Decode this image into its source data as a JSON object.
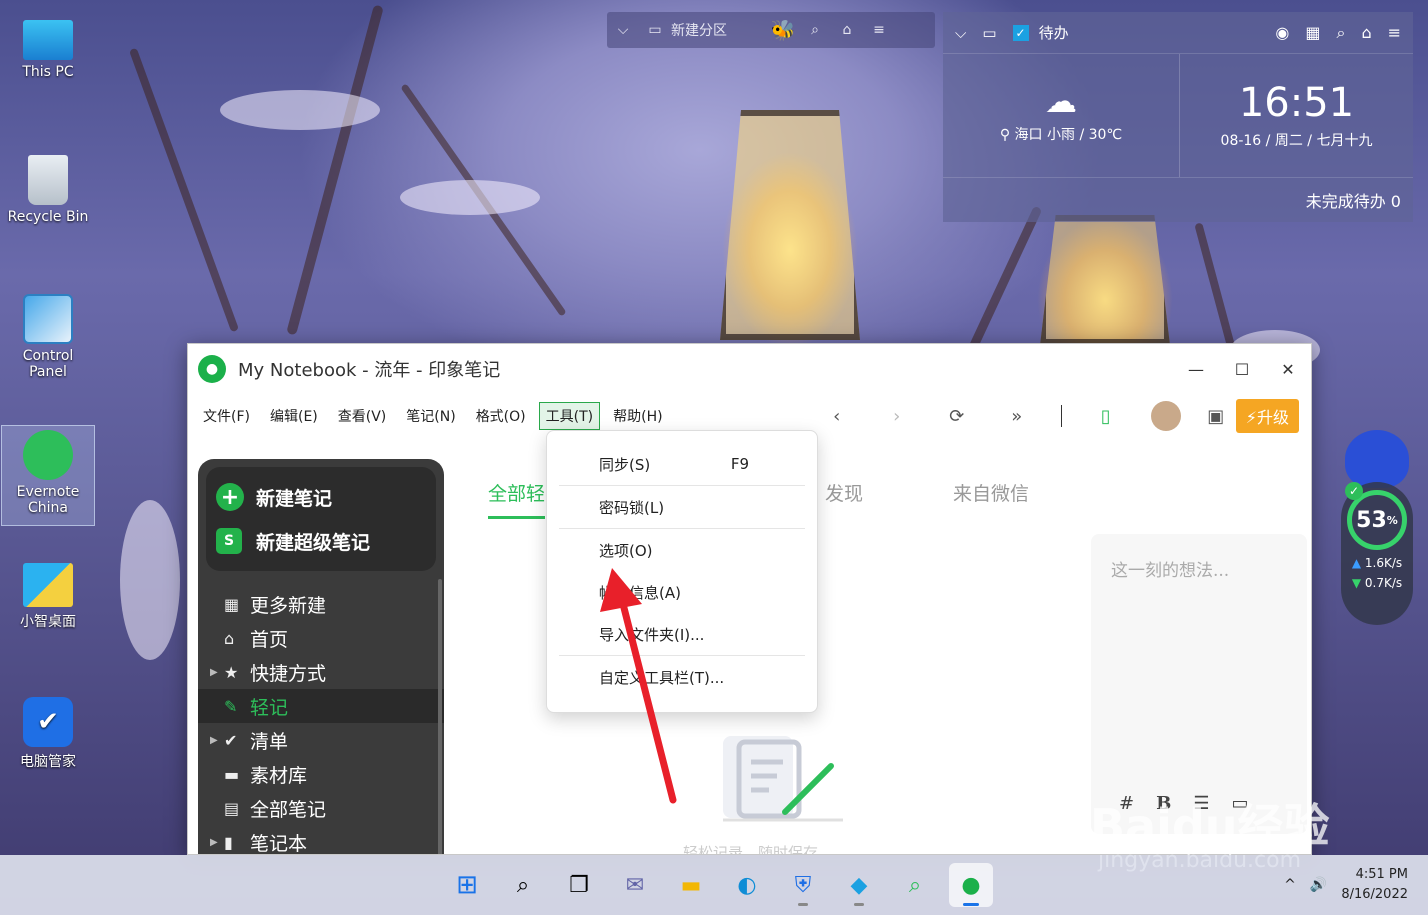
{
  "desktop": {
    "icons": [
      {
        "label": "This PC"
      },
      {
        "label": "Recycle Bin"
      },
      {
        "label": "Control Panel"
      },
      {
        "label": "Evernote China"
      },
      {
        "label": "小智桌面"
      },
      {
        "label": "电脑管家"
      }
    ]
  },
  "top_widget": {
    "partition_label": "新建分区"
  },
  "todo_widget": {
    "title": "待办",
    "weather": "海口  小雨 / 30℃",
    "time": "16:51",
    "date": "08-16 / 周二 / 七月十九",
    "pending": "未完成待办 0"
  },
  "window": {
    "title": "My Notebook - 流年 - 印象笔记",
    "menu": [
      "文件(F)",
      "编辑(E)",
      "查看(V)",
      "笔记(N)",
      "格式(O)",
      "工具(T)",
      "帮助(H)"
    ],
    "upgrade_label": "升级",
    "sidebar": {
      "new_note": "新建笔记",
      "new_super_note": "新建超级笔记",
      "items": [
        {
          "label": "更多新建"
        },
        {
          "label": "首页"
        },
        {
          "label": "快捷方式"
        },
        {
          "label": "轻记"
        },
        {
          "label": "清单"
        },
        {
          "label": "素材库"
        },
        {
          "label": "全部笔记"
        },
        {
          "label": "笔记本"
        }
      ]
    },
    "tabs": [
      "全部轻",
      "发现",
      "来自微信"
    ],
    "note_placeholder": "这一刻的想法...",
    "empty_text": "轻松记录，随时保存"
  },
  "tools_menu": {
    "items": [
      {
        "label": "同步(S)",
        "shortcut": "F9"
      },
      {
        "label": "密码锁(L)"
      },
      {
        "label": "选项(O)"
      },
      {
        "label": "帐户信息(A)"
      },
      {
        "label": "导入文件夹(I)..."
      },
      {
        "label": "自定义工具栏(T)..."
      }
    ]
  },
  "speed_widget": {
    "percent": "53",
    "unit": "%",
    "up": "1.6K/s",
    "down": "0.7K/s"
  },
  "taskbar": {
    "time": "4:51 PM",
    "date": "8/16/2022"
  },
  "watermark": {
    "brand": "Baidu经验",
    "url": "jingyan.baidu.com"
  },
  "colors": {
    "accent_green": "#2dbe5a",
    "upgrade_orange": "#f5a623",
    "arrow_red": "#e8202a"
  }
}
